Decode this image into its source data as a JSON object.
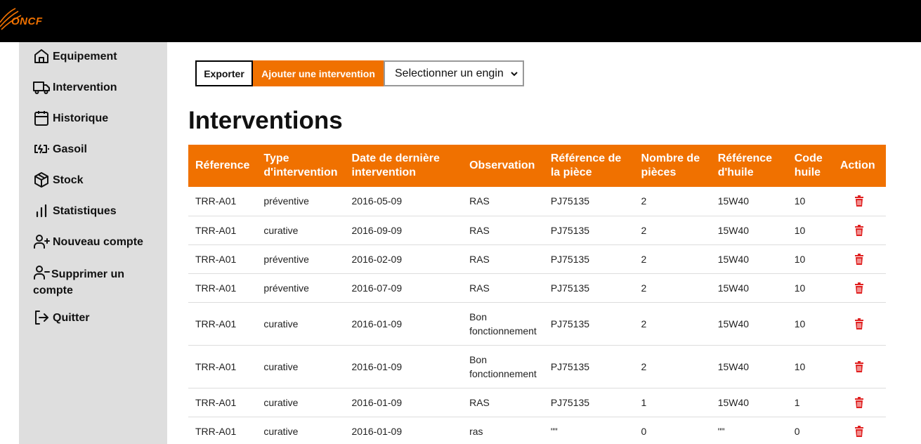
{
  "header": {
    "logo_text": "ONCF",
    "brand_color": "#f07100"
  },
  "sidebar": {
    "items": [
      {
        "label": "Equipement",
        "icon": "home-icon"
      },
      {
        "label": "Intervention",
        "icon": "truck-icon"
      },
      {
        "label": "Historique",
        "icon": "calendar-icon"
      },
      {
        "label": "Gasoil",
        "icon": "battery-charging-icon"
      },
      {
        "label": "Stock",
        "icon": "box-icon"
      },
      {
        "label": "Statistiques",
        "icon": "bar-chart-icon"
      },
      {
        "label": "Nouveau compte",
        "icon": "user-plus-icon"
      },
      {
        "label": "Supprimer un compte",
        "icon": "user-minus-icon"
      },
      {
        "label": "Quitter",
        "icon": "logout-icon"
      }
    ]
  },
  "toolbar": {
    "export_label": "Exporter",
    "add_label": "Ajouter une intervention",
    "select_value": "Selectionner un engin"
  },
  "main": {
    "title": "Interventions",
    "columns": [
      "Réference",
      "Type d'intervention",
      "Date de dernière intervention",
      "Observation",
      "Référence de la pièce",
      "Nombre de pièces",
      "Référence d'huile",
      "Code huile",
      "Action"
    ],
    "rows": [
      [
        "TRR-A01",
        "préventive",
        "2016-05-09",
        "RAS",
        "PJ75135",
        "2",
        "15W40",
        "10"
      ],
      [
        "TRR-A01",
        "curative",
        "2016-09-09",
        "RAS",
        "PJ75135",
        "2",
        "15W40",
        "10"
      ],
      [
        "TRR-A01",
        "préventive",
        "2016-02-09",
        "RAS",
        "PJ75135",
        "2",
        "15W40",
        "10"
      ],
      [
        "TRR-A01",
        "préventive",
        "2016-07-09",
        "RAS",
        "PJ75135",
        "2",
        "15W40",
        "10"
      ],
      [
        "TRR-A01",
        "curative",
        "2016-01-09",
        "Bon fonctionnement",
        "PJ75135",
        "2",
        "15W40",
        "10"
      ],
      [
        "TRR-A01",
        "curative",
        "2016-01-09",
        "Bon fonctionnement",
        "PJ75135",
        "2",
        "15W40",
        "10"
      ],
      [
        "TRR-A01",
        "curative",
        "2016-01-09",
        "RAS",
        "PJ75135",
        "1",
        "15W40",
        "1"
      ],
      [
        "TRR-A01",
        "curative",
        "2016-01-09",
        "ras",
        "\"\"",
        "0",
        "\"\"",
        "0"
      ]
    ],
    "action_icon": "trash-icon",
    "action_color": "#e02020"
  }
}
